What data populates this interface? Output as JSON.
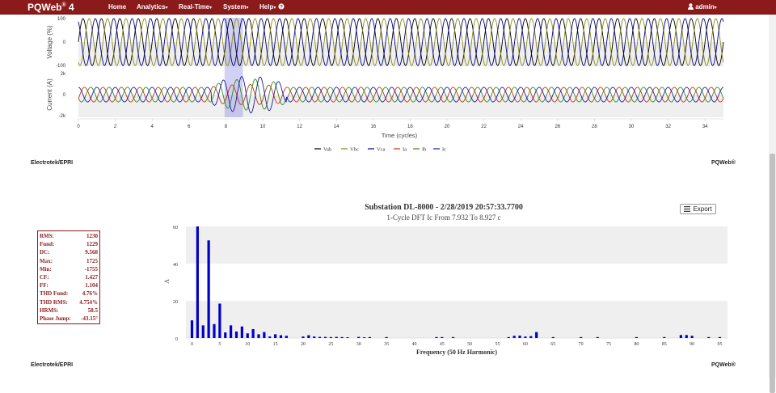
{
  "navbar": {
    "brand": "PQWeb",
    "brand_sup": "®",
    "brand_version": " 4",
    "items": [
      {
        "label": "Home"
      },
      {
        "label": "Analytics"
      },
      {
        "label": "Real-Time"
      },
      {
        "label": "System"
      },
      {
        "label": "Help"
      }
    ],
    "user": "admin"
  },
  "waveform": {
    "voltage_ylabel": "Voltage (%)",
    "current_ylabel": "Current (A)",
    "voltage_ticks": [
      "100",
      "0",
      "-100"
    ],
    "current_ticks": [
      "2k",
      "0",
      "-2k"
    ],
    "x_ticks": [
      "0",
      "2",
      "4",
      "6",
      "8",
      "10",
      "12",
      "14",
      "16",
      "18",
      "20",
      "22",
      "24",
      "26",
      "28",
      "30",
      "32",
      "34"
    ],
    "xlabel": "Time (cycles)",
    "legend": [
      {
        "name": "Vab",
        "color": "#000000"
      },
      {
        "name": "Vbc",
        "color": "#8b8b1a"
      },
      {
        "name": "Vca",
        "color": "#00008b"
      },
      {
        "name": "Ia",
        "color": "#cc3300"
      },
      {
        "name": "Ib",
        "color": "#2e8b22"
      },
      {
        "name": "Ic",
        "color": "#1a1aaa"
      }
    ],
    "footer_left": "Electrotek/EPRI",
    "footer_right": "PQWeb®"
  },
  "chart_data": [
    {
      "type": "line",
      "xlabel": "Time (cycles)",
      "ylabel": "Voltage (%)",
      "xlim": [
        0,
        35
      ],
      "ylim": [
        -100,
        100
      ],
      "series": [
        {
          "name": "Vab",
          "amplitude": 100,
          "phase_deg": 0
        },
        {
          "name": "Vbc",
          "amplitude": 100,
          "phase_deg": -120
        },
        {
          "name": "Vca",
          "amplitude": 100,
          "phase_deg": 120
        }
      ]
    },
    {
      "type": "line",
      "xlabel": "Time (cycles)",
      "ylabel": "Current (A)",
      "xlim": [
        0,
        35
      ],
      "ylim": [
        -2000,
        2000
      ],
      "series": [
        {
          "name": "Ia",
          "amplitude": 700,
          "phase_deg": -30
        },
        {
          "name": "Ib",
          "amplitude": 700,
          "phase_deg": -150
        },
        {
          "name": "Ic",
          "amplitude": 700,
          "phase_deg": 90
        }
      ],
      "fault_interval": [
        7.2,
        11.3
      ],
      "fault_peak": 1750,
      "highlight": [
        7.932,
        8.927
      ]
    },
    {
      "type": "bar",
      "title": "Substation DL-8000 - 2/28/2019 20:57:33.7700",
      "subtitle": "1-Cycle DFT Ic From 7.932 To 8.927 c",
      "xlabel": "Frequency (50 Hz Harmonic)",
      "ylabel": "A",
      "xlim": [
        0,
        95
      ],
      "ylim": [
        0,
        60
      ],
      "y_ticks": [
        "0",
        "20",
        "40",
        "60"
      ],
      "x_ticks": [
        "0",
        "5",
        "10",
        "15",
        "20",
        "25",
        "30",
        "35",
        "40",
        "45",
        "50",
        "55",
        "60",
        "65",
        "70",
        "75",
        "80",
        "85",
        "90",
        "95"
      ],
      "x": [
        0,
        1,
        2,
        3,
        4,
        5,
        6,
        7,
        8,
        9,
        10,
        11,
        12,
        13,
        14,
        15,
        16,
        17,
        20,
        21,
        22,
        23,
        24,
        25,
        26,
        27,
        28,
        30,
        31,
        32,
        35,
        44,
        45,
        47,
        57,
        58,
        59,
        60,
        61,
        62,
        65,
        70,
        73,
        80,
        85,
        88,
        89,
        90,
        93,
        95
      ],
      "values": [
        9.5,
        60,
        6.8,
        52.5,
        7.5,
        18.5,
        3,
        6.8,
        3.5,
        6.2,
        2.5,
        4.8,
        2,
        3.2,
        0.8,
        2,
        1.5,
        1.2,
        0.8,
        1.5,
        0.8,
        0.6,
        0.6,
        0.5,
        0.6,
        0.5,
        0.4,
        0.6,
        0.4,
        0.5,
        0.5,
        0.5,
        0.5,
        0.5,
        0.5,
        1.2,
        1.3,
        0.8,
        1,
        3.2,
        0.5,
        0.5,
        0.5,
        0.5,
        0.5,
        1.6,
        1.6,
        1.2,
        0.5,
        0.5
      ]
    }
  ],
  "stats": [
    {
      "label": "RMS:",
      "value": "1230"
    },
    {
      "label": "Fund:",
      "value": "1229"
    },
    {
      "label": "DC:",
      "value": "9.568"
    },
    {
      "label": "Max:",
      "value": "1725"
    },
    {
      "label": "Min:",
      "value": "-1755"
    },
    {
      "label": "CF:",
      "value": "1.427"
    },
    {
      "label": "FF:",
      "value": "1.104"
    },
    {
      "label": "THD Fund:",
      "value": "4.76%"
    },
    {
      "label": "THD RMS:",
      "value": "4.754%"
    },
    {
      "label": "HRMS:",
      "value": "58.5"
    },
    {
      "label": "Phase Jump:",
      "value": "-43.15°"
    }
  ],
  "harmonics": {
    "export_label": "Export",
    "footer_left": "Electrotek/EPRI",
    "footer_right": "PQWeb®"
  },
  "colors": {
    "navbar": "#8b1a1a",
    "bar": "#0000cc",
    "band": "#efefef"
  }
}
